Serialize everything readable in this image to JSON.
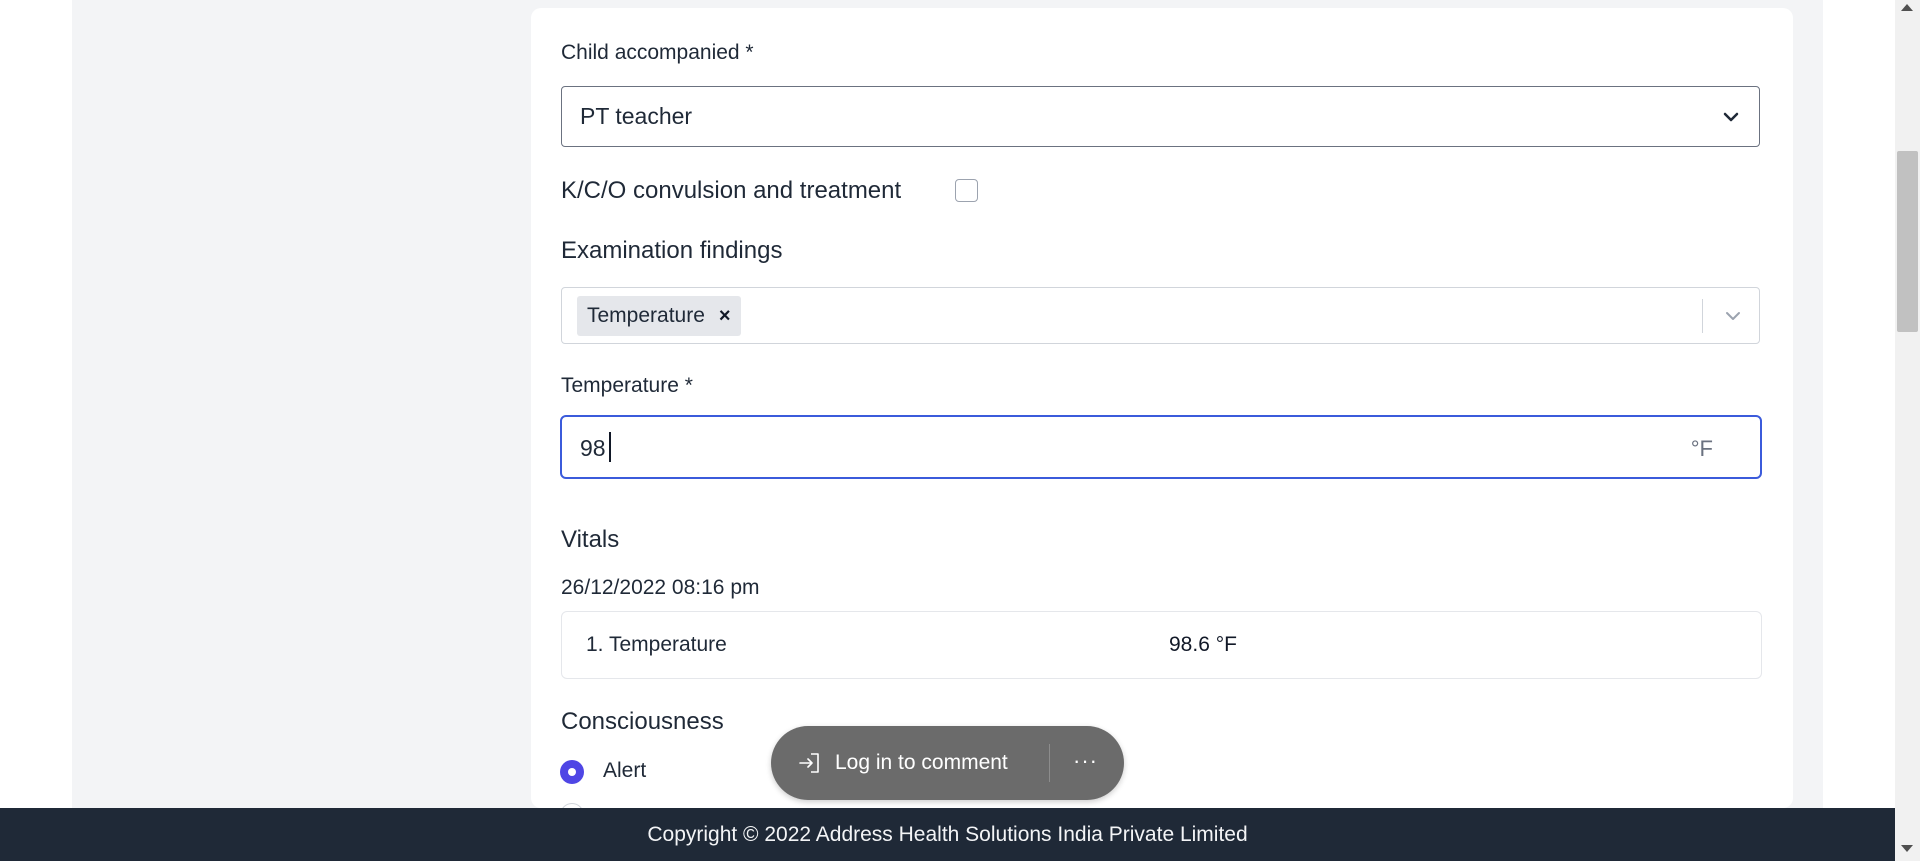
{
  "form": {
    "child_accompanied": {
      "label": "Child accompanied *",
      "value": "PT teacher"
    },
    "kco_convulsion": {
      "label": "K/C/O convulsion and treatment",
      "checked": false
    },
    "examination_findings": {
      "label": "Examination findings",
      "chips": [
        "Temperature"
      ],
      "chip_remove": "×"
    },
    "temperature": {
      "label": "Temperature *",
      "value": "98",
      "unit": "°F"
    },
    "vitals": {
      "heading": "Vitals",
      "timestamp": "26/12/2022 08:16 pm",
      "rows": [
        {
          "name": "1. Temperature",
          "value": "98.6 °F"
        }
      ]
    },
    "consciousness": {
      "heading": "Consciousness",
      "options": [
        {
          "label": "Alert",
          "selected": true
        },
        {
          "label": "",
          "selected": false
        }
      ]
    }
  },
  "comment_bar": {
    "login_label": "Log in to comment",
    "more_label": "···"
  },
  "footer": {
    "copyright": "Copyright © 2022 Address Health Solutions India Private Limited"
  },
  "colors": {
    "accent": "#4f46e5",
    "focus_border": "#3b5bdb",
    "footer_bg": "#1f2937",
    "page_bg": "#f3f4f6"
  }
}
